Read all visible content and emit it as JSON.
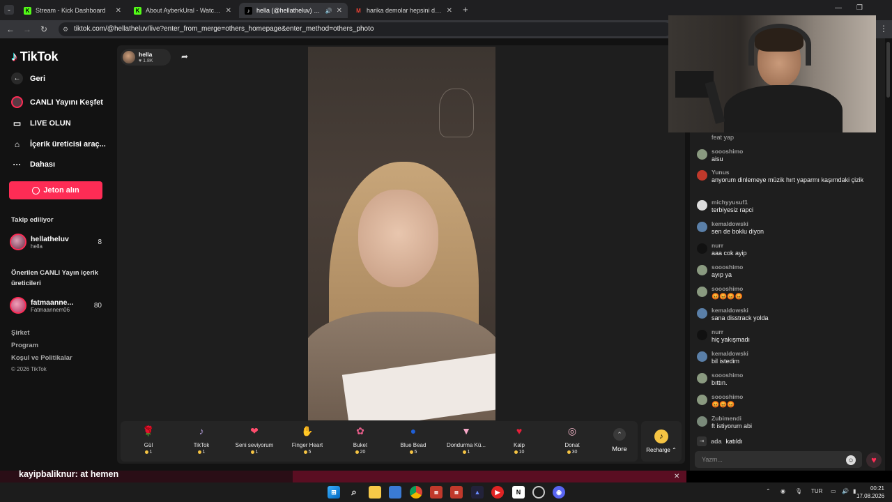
{
  "browser": {
    "tabs": [
      {
        "label": "Stream - Kick Dashboard",
        "icon": "kick-icon",
        "active": false
      },
      {
        "label": "About AyberkUral - Watch Live",
        "icon": "kick-icon",
        "active": false
      },
      {
        "label": "hella (@hellatheluv) CANLI",
        "icon": "tiktok-icon",
        "active": true
      },
      {
        "label": "harika demolar hepsini dinle k",
        "icon": "gmail-icon",
        "active": false
      }
    ],
    "url": "tiktok.com/@hellatheluv/live?enter_from_merge=others_homepage&enter_method=others_photo"
  },
  "sidebar": {
    "logo": "TikTok",
    "back": "Geri",
    "nav": [
      "CANLI Yayını Keşfet",
      "LIVE OLUN",
      "İçerik üreticisi araç...",
      "Dahası"
    ],
    "coins_button": "Jeton alın",
    "following_title": "Takip ediliyor",
    "following": [
      {
        "name": "hellatheluv",
        "sub": "hella",
        "count": "8"
      }
    ],
    "suggested_title": "Önerilen CANLI Yayın içerik üreticileri",
    "suggested": [
      {
        "name": "fatmaanne...",
        "sub": "Fatmaannem06",
        "count": "80"
      }
    ],
    "footer": [
      "Şirket",
      "Program",
      "Koşul ve Politikalar",
      "© 2026 TikTok"
    ]
  },
  "stream": {
    "host_name": "hella",
    "host_likes": "1.8K"
  },
  "gifts": [
    {
      "name": "Gül",
      "price": "1",
      "icon": "rose-icon",
      "color": "#e0245e",
      "glyph": "🌹"
    },
    {
      "name": "TikTok",
      "price": "1",
      "icon": "tiktok-gift-icon",
      "color": "#b19cd9",
      "glyph": "♪"
    },
    {
      "name": "Seni seviyorum",
      "price": "1",
      "icon": "love-you-icon",
      "color": "#ff4d6d",
      "glyph": "❤"
    },
    {
      "name": "Finger Heart",
      "price": "5",
      "icon": "finger-heart-icon",
      "color": "#ffb38a",
      "glyph": "✋"
    },
    {
      "name": "Buket",
      "price": "20",
      "icon": "bouquet-icon",
      "color": "#e85d8a",
      "glyph": "✿"
    },
    {
      "name": "Blue Bead",
      "price": "5",
      "icon": "blue-bead-icon",
      "color": "#1f5fd6",
      "glyph": "●"
    },
    {
      "name": "Dondurma Kü...",
      "price": "1",
      "icon": "ice-cream-icon",
      "color": "#f7a8c8",
      "glyph": "▼"
    },
    {
      "name": "Kalp",
      "price": "10",
      "icon": "heart-icon",
      "color": "#e8203a",
      "glyph": "♥"
    },
    {
      "name": "Donat",
      "price": "30",
      "icon": "donut-icon",
      "color": "#f3b6c8",
      "glyph": "◎"
    }
  ],
  "more_label": "More",
  "recharge_label": "Recharge",
  "chat": {
    "partial": "feat yap",
    "messages": [
      {
        "user": "soooshimo",
        "text": "aisu",
        "color": "#8a9a80"
      },
      {
        "user": "Yunus",
        "text": "anyorum dinlemeye müzik hırt yaparmı kaşımdaki çizik",
        "color": "#c0392b"
      },
      {
        "user": "michyyusuf1",
        "text": "terbiyesiz rapci",
        "color": "#dddddd"
      },
      {
        "user": "kemaldowski",
        "text": "sen de boklu diyon",
        "color": "#5a7fa8"
      },
      {
        "user": "nurr",
        "text": "aaa cok ayip",
        "color": "#111111"
      },
      {
        "user": "soooshimo",
        "text": "ayıp ya",
        "color": "#8a9a80"
      },
      {
        "user": "soooshimo",
        "text": "😡😡😡😡",
        "color": "#8a9a80"
      },
      {
        "user": "kemaldowski",
        "text": "sana disstrack yolda",
        "color": "#5a7fa8"
      },
      {
        "user": "nurr",
        "text": "hiç yakışmadı",
        "color": "#111111"
      },
      {
        "user": "kemaldowski",
        "text": "bil istedim",
        "color": "#5a7fa8"
      },
      {
        "user": "soooshimo",
        "text": "bıttın.",
        "color": "#8a9a80"
      },
      {
        "user": "soooshimo",
        "text": "😡😡😡",
        "color": "#8a9a80"
      },
      {
        "user": "Zubimendi",
        "text": "ft istiyorum abi",
        "color": "#7a8a7a"
      }
    ],
    "join_user": "ada",
    "join_text": "katıldı",
    "input_placeholder": "Yazm..."
  },
  "overlay": {
    "user": "kayipbaliknur",
    "text": ": at hemen"
  },
  "taskbar": {
    "lang": "TUR",
    "time": "00:21",
    "date": "17.08.2026"
  },
  "colors": {
    "accent": "#fe2c55",
    "coin": "#f6c443"
  }
}
